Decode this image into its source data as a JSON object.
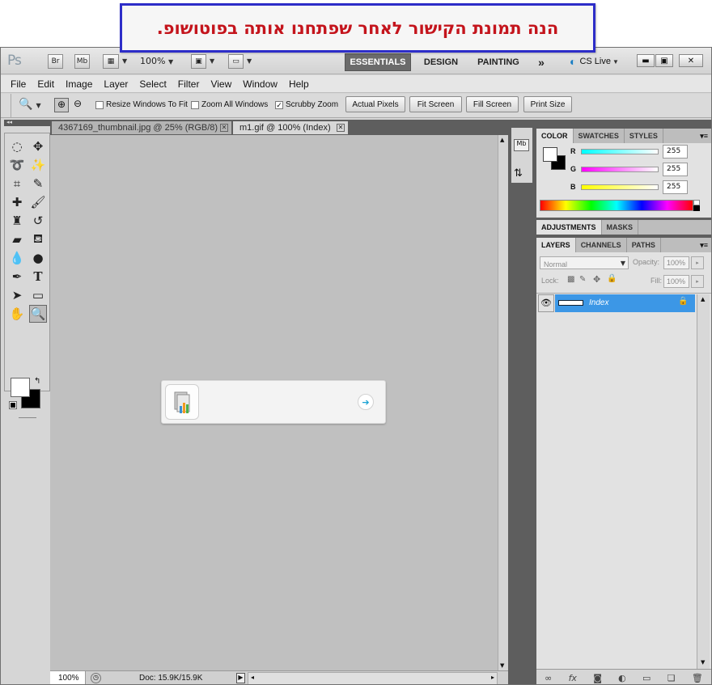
{
  "banner": {
    "text": "הנה תמונת הקישור לאחר שפתחנו אותה בפוטושופ."
  },
  "appbar": {
    "logo": "Ps",
    "br": "Br",
    "mb": "Mb",
    "zoom": "100%",
    "workspaces": [
      "ESSENTIALS",
      "DESIGN",
      "PAINTING"
    ],
    "more": "»",
    "cslive": "CS Live"
  },
  "menu": [
    "File",
    "Edit",
    "Image",
    "Layer",
    "Select",
    "Filter",
    "View",
    "Window",
    "Help"
  ],
  "options": {
    "resize": "Resize Windows To Fit",
    "zoom_all": "Zoom All Windows",
    "scrubby": "Scrubby Zoom",
    "actual": "Actual Pixels",
    "fit": "Fit Screen",
    "fill": "Fill Screen",
    "print": "Print Size"
  },
  "tabs": [
    "4367169_thumbnail.jpg @ 25% (RGB/8)",
    "m1.gif @ 100% (Index)"
  ],
  "status": {
    "zoom": "100%",
    "doc": "Doc: 15.9K/15.9K"
  },
  "color_panel": {
    "tabs": [
      "COLOR",
      "SWATCHES",
      "STYLES"
    ],
    "r_label": "R",
    "g_label": "G",
    "b_label": "B",
    "r": "255",
    "g": "255",
    "b": "255"
  },
  "adjust_panel": {
    "tabs": [
      "ADJUSTMENTS",
      "MASKS"
    ]
  },
  "layers_panel": {
    "tabs": [
      "LAYERS",
      "CHANNELS",
      "PATHS"
    ],
    "blend": "Normal",
    "opacity_label": "Opacity:",
    "opacity": "100%",
    "lock_label": "Lock:",
    "fill_label": "Fill:",
    "fill": "100%",
    "layer_name": "Index"
  },
  "colors": {
    "accent_layer": "#3c97e6",
    "banner_text": "#c4141c",
    "banner_border": "#2d2dc8"
  }
}
